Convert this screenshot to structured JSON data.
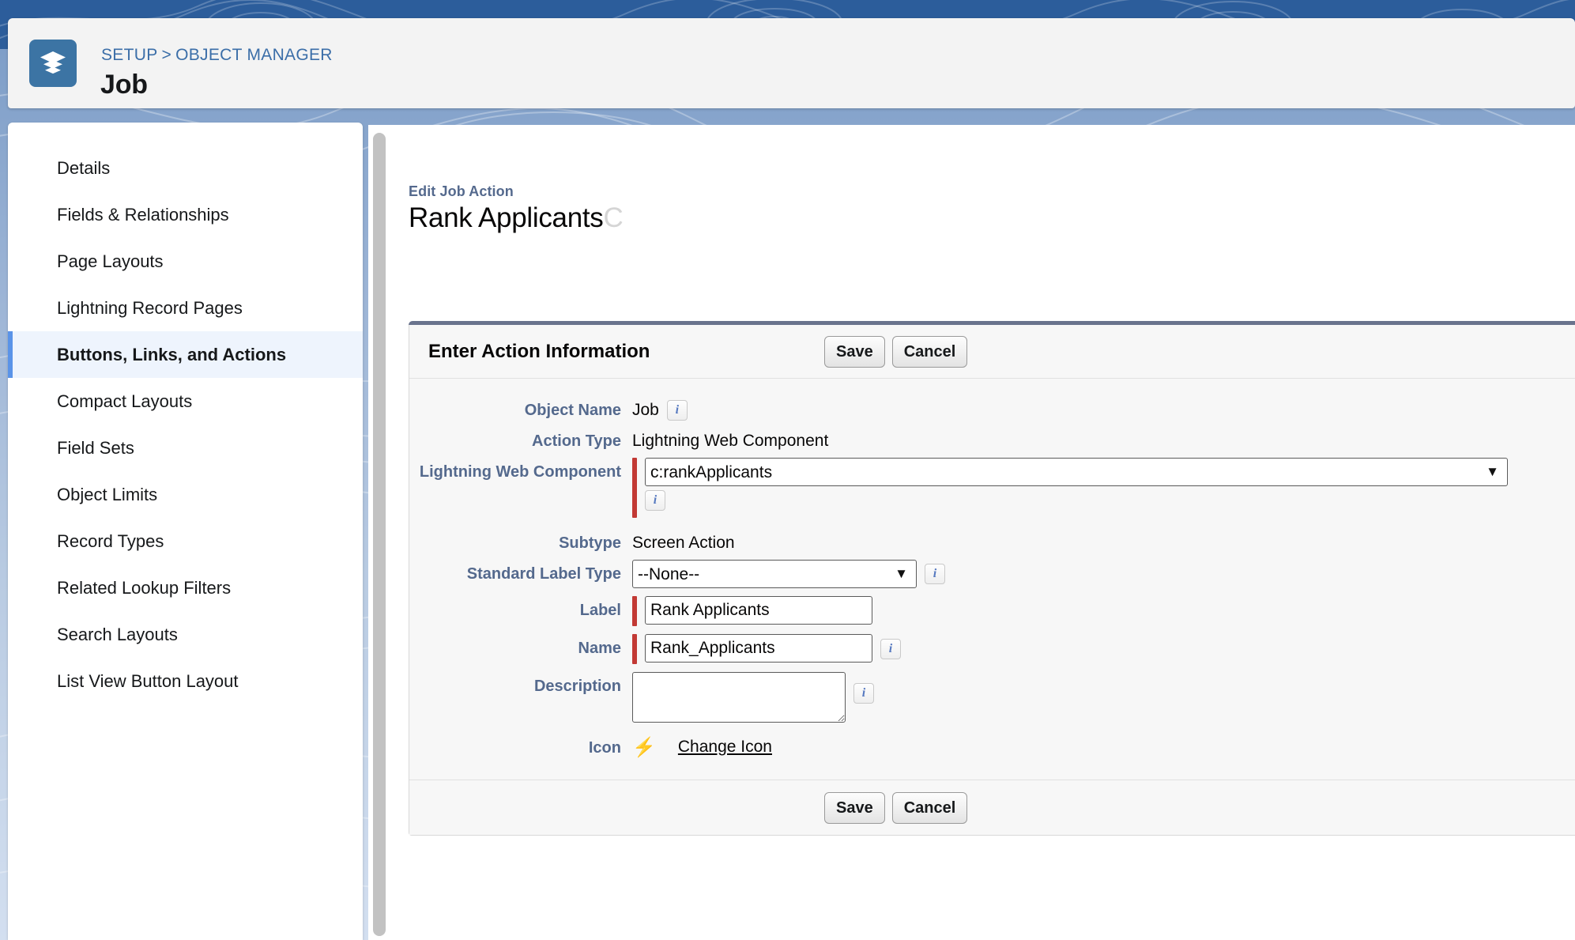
{
  "header": {
    "object_icon": "layers-stack-icon",
    "breadcrumb": {
      "setup": "SETUP",
      "separator": ">",
      "object_manager": "OBJECT MANAGER"
    },
    "title": "Job"
  },
  "sidebar": {
    "items": [
      {
        "label": "Details",
        "active": false
      },
      {
        "label": "Fields & Relationships",
        "active": false
      },
      {
        "label": "Page Layouts",
        "active": false
      },
      {
        "label": "Lightning Record Pages",
        "active": false
      },
      {
        "label": "Buttons, Links, and Actions",
        "active": true
      },
      {
        "label": "Compact Layouts",
        "active": false
      },
      {
        "label": "Field Sets",
        "active": false
      },
      {
        "label": "Object Limits",
        "active": false
      },
      {
        "label": "Record Types",
        "active": false
      },
      {
        "label": "Related Lookup Filters",
        "active": false
      },
      {
        "label": "Search Layouts",
        "active": false
      },
      {
        "label": "List View Button Layout",
        "active": false
      }
    ]
  },
  "content": {
    "eyebrow": "Edit Job Action",
    "record_title": "Rank Applicants",
    "record_title_clipped": "C"
  },
  "form": {
    "panel_title": "Enter Action Information",
    "save_label": "Save",
    "cancel_label": "Cancel",
    "fields": {
      "object_name": {
        "label": "Object Name",
        "value": "Job"
      },
      "action_type": {
        "label": "Action Type",
        "value": "Lightning Web Component"
      },
      "lightning_web_component": {
        "label": "Lightning Web Component",
        "value": "c:rankApplicants"
      },
      "subtype": {
        "label": "Subtype",
        "value": "Screen Action"
      },
      "standard_label_type": {
        "label": "Standard Label Type",
        "value": "--None--"
      },
      "label": {
        "label": "Label",
        "value": "Rank Applicants"
      },
      "name": {
        "label": "Name",
        "value": "Rank_Applicants"
      },
      "description": {
        "label": "Description",
        "value": ""
      },
      "icon": {
        "label": "Icon",
        "glyph": "lightning-bolt-icon",
        "change_link": "Change Icon"
      }
    }
  },
  "colors": {
    "brand_blue": "#2c5d9b",
    "link_blue": "#3b6ea8",
    "label_slate": "#54698d",
    "required_red": "#c23934",
    "panel_topbar": "#69738d",
    "active_nav_border": "#5a93e8",
    "active_nav_bg": "#eef4fd"
  }
}
